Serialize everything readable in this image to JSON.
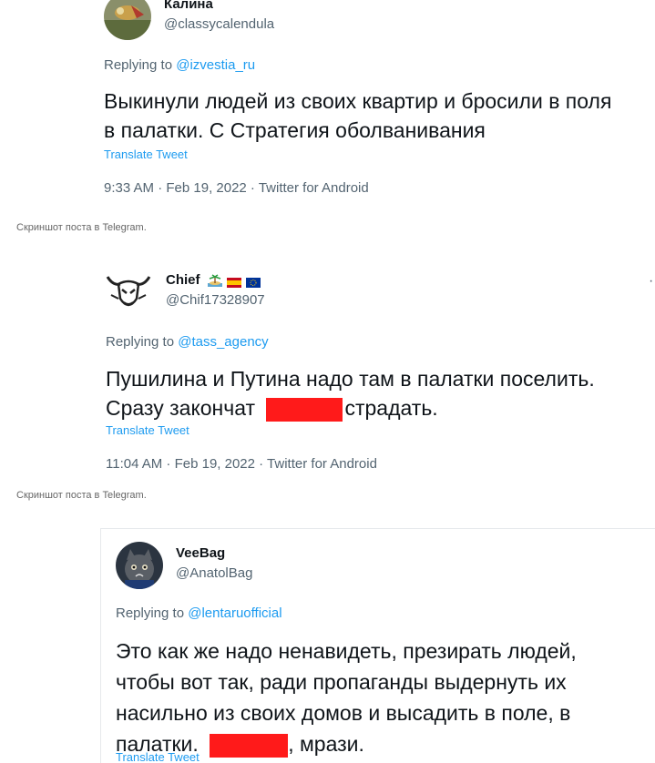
{
  "tweets": [
    {
      "name": "Калина",
      "handle": "@classycalendula",
      "replying_prefix": "Replying to",
      "replying_to": "@izvestia_ru",
      "text_line1": "Выкинули людей из своих квартир и бросили в поля",
      "text_line2": "в палатки. С Стратегия оболванивания",
      "translate": "Translate Tweet",
      "meta": "9:33 AM · Feb 19, 2022 · Twitter for Android"
    },
    {
      "name": "Chief",
      "handle": "@Chif17328907",
      "replying_prefix": "Replying to",
      "replying_to": "@tass_agency",
      "text_line1": "Пушилина и Путина надо там в палатки поселить.",
      "text_line2_before": "Сразу закончат",
      "text_line2_after": "страдать.",
      "translate": "Translate Tweet",
      "meta": "11:04 AM · Feb 19, 2022 · Twitter for Android"
    },
    {
      "name": "VeeBag",
      "handle": "@AnatolBag",
      "replying_prefix": "Replying to",
      "replying_to": "@lentaruofficial",
      "text_line1": "Это как же надо ненавидеть, презирать людей,",
      "text_line2": "чтобы вот так, ради пропаганды выдернуть их",
      "text_line3": "насильно из своих домов и высадить в поле, в",
      "text_line4_before": "палатки.",
      "text_line4_after": ", мрази.",
      "translate": "Translate Tweet"
    }
  ],
  "captions": {
    "first": "Скриншот поста в Telegram.",
    "second": "Скриншот поста в Telegram."
  },
  "colors": {
    "link": "#1d9bf0",
    "secondary": "#536471",
    "redaction": "#ff1a1a"
  }
}
